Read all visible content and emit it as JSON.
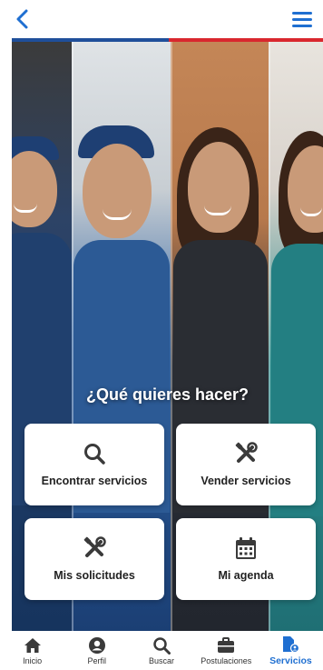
{
  "header": {
    "back_icon": "chevron-left-icon",
    "menu_icon": "hamburger-menu-icon"
  },
  "colors": {
    "accent_blue": "#1f6fd1",
    "stripe_blue": "#1f4f9a",
    "stripe_red": "#d9272e",
    "icon_dark": "#3a3a3a"
  },
  "hero": {
    "title": "¿Qué quieres hacer?"
  },
  "actions": [
    {
      "label": "Encontrar servicios",
      "icon": "search-icon"
    },
    {
      "label": "Vender servicios",
      "icon": "tools-icon"
    },
    {
      "label": "Mis solicitudes",
      "icon": "tools-icon"
    },
    {
      "label": "Mi agenda",
      "icon": "calendar-icon"
    }
  ],
  "nav": {
    "items": [
      {
        "label": "Inicio",
        "icon": "home-icon",
        "active": false
      },
      {
        "label": "Perfil",
        "icon": "user-icon",
        "active": false
      },
      {
        "label": "Buscar",
        "icon": "search-icon",
        "active": false
      },
      {
        "label": "Postulaciones",
        "icon": "briefcase-icon",
        "active": false
      },
      {
        "label": "Servicios",
        "icon": "file-user-icon",
        "active": true
      }
    ]
  }
}
